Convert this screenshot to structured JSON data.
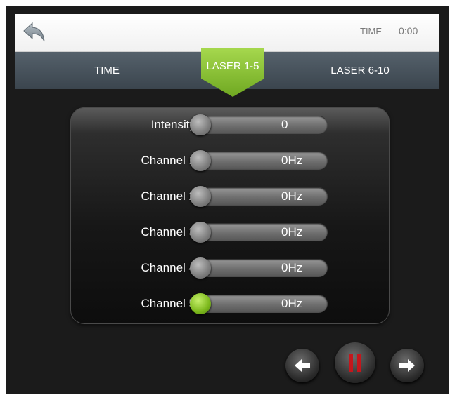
{
  "header": {
    "back_icon": "back-arrow-icon",
    "time_label": "TIME",
    "time_value": "0:00"
  },
  "tabs": [
    {
      "label": "TIME",
      "active": false
    },
    {
      "label": "LASER 1-5",
      "active": true
    },
    {
      "label": "LASER 6-10",
      "active": false
    }
  ],
  "sliders": [
    {
      "label": "Intensity",
      "value_text": "0",
      "level": 0,
      "knob_color": "#8a8a8a"
    },
    {
      "label": "Channel 1",
      "value_text": "0Hz",
      "level": 0,
      "knob_color": "#8a8a8a"
    },
    {
      "label": "Channel 2",
      "value_text": "0Hz",
      "level": 0,
      "knob_color": "#8a8a8a"
    },
    {
      "label": "Channel 3",
      "value_text": "0Hz",
      "level": 0,
      "knob_color": "#8a8a8a"
    },
    {
      "label": "Channel 4",
      "value_text": "0Hz",
      "level": 0,
      "knob_color": "#8a8a8a"
    },
    {
      "label": "Channel 5",
      "value_text": "0Hz",
      "level": 0,
      "knob_color": "#7cb81c"
    }
  ],
  "controls": {
    "prev_icon": "left-arrow-icon",
    "pause_icon": "pause-icon",
    "next_icon": "right-arrow-icon",
    "pause_color": "#c4161c"
  },
  "colors": {
    "accent_green": "#8cc63f",
    "tab_bar": "#47525b"
  }
}
